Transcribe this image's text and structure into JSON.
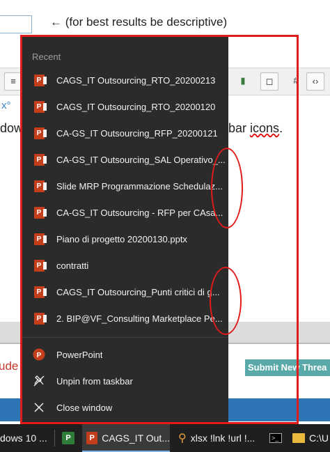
{
  "background_page": {
    "hint_text": "(for best results be descriptive)",
    "hint_arrow": "←",
    "toolbar_buttons": [
      "align-left-icon",
      "film-icon",
      "comment-icon",
      "hash-icon",
      "code-icon"
    ],
    "superscript_text": "x°",
    "line_left": "dow",
    "line_right_plain": "bar ",
    "line_right_underlined": "icons",
    "line_right_end": ".",
    "lude_text": "ude",
    "submit_button": "Submit New Threa"
  },
  "jumplist": {
    "header": "Recent",
    "recent_items": [
      {
        "label": "CAGS_IT Outsourcing_RTO_20200213",
        "icon": "powerpoint-file-icon"
      },
      {
        "label": "CAGS_IT Outsourcing_RTO_20200120",
        "icon": "powerpoint-file-icon"
      },
      {
        "label": "CA-GS_IT Outsourcing_RFP_20200121",
        "icon": "powerpoint-file-icon"
      },
      {
        "label": "CA-GS_IT Outsourcing_SAL Operativo_...",
        "icon": "powerpoint-file-icon"
      },
      {
        "label": "Slide MRP Programmazione Schedulaz...",
        "icon": "powerpoint-file-icon"
      },
      {
        "label": "CA-GS_IT Outsourcing - RFP per CAsa...",
        "icon": "powerpoint-file-icon"
      },
      {
        "label": "Piano di progetto 20200130.pptx",
        "icon": "powerpoint-file-icon"
      },
      {
        "label": "contratti",
        "icon": "powerpoint-file-icon"
      },
      {
        "label": "CAGS_IT Outsourcing_Punti critici di g...",
        "icon": "powerpoint-file-icon"
      },
      {
        "label": "2. BIP@VF_Consulting Marketplace Pe...",
        "icon": "powerpoint-file-icon"
      }
    ],
    "tasks": [
      {
        "label": "PowerPoint",
        "icon": "powerpoint-app-icon"
      },
      {
        "label": "Unpin from taskbar",
        "icon": "unpin-icon"
      },
      {
        "label": "Close window",
        "icon": "close-icon"
      }
    ]
  },
  "taskbar": {
    "items": [
      {
        "label": "dows 10 ...",
        "icon": "none"
      },
      {
        "label": "",
        "icon": "project-app-icon"
      },
      {
        "label": "CAGS_IT Out...",
        "icon": "powerpoint-app-icon",
        "active": true
      },
      {
        "label": "xlsx !lnk !url !...",
        "icon": "search-icon"
      },
      {
        "label": "",
        "icon": "cmd-icon"
      },
      {
        "label": "C:\\U",
        "icon": "folder-icon"
      }
    ]
  },
  "colors": {
    "jumplist_bg": "#2b2b2b",
    "powerpoint": "#c43e1c",
    "annotation_red": "#e01b1b",
    "taskbar_bg": "#1f1f1f"
  }
}
